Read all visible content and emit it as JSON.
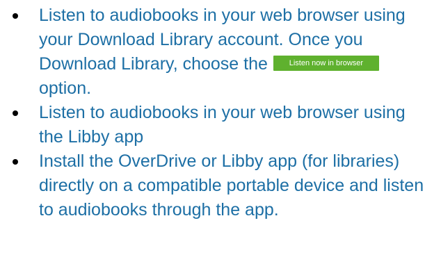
{
  "bullets": [
    {
      "text_before": "Listen to audiobooks in your web browser using your Download Library account. Once you Download Library, choose the",
      "button_label": "Listen now in browser",
      "text_after": "option."
    },
    {
      "text": "Listen to audiobooks in your web browser using the Libby app"
    },
    {
      "text": "Install the OverDrive or Libby app (for libraries) directly on a compatible portable device and listen to audiobooks through the app."
    }
  ],
  "colors": {
    "text": "#1d6fa5",
    "button_bg": "#5fb12e",
    "button_text": "#ffffff",
    "bullet": "#000000"
  }
}
